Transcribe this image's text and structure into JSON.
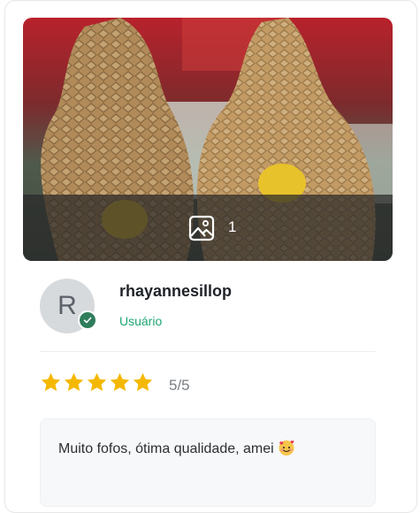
{
  "review": {
    "photo": {
      "icon": "image-icon",
      "count": "1"
    },
    "user": {
      "avatar_initial": "R",
      "name": "rhayannesillop",
      "role": "Usuário",
      "verified_icon": "check-badge-icon"
    },
    "rating": {
      "value": 5,
      "max": 5,
      "text": "5/5",
      "star_color": "#f5b800"
    },
    "comment": {
      "text": "Muito fofos, ótima qualidade, amei",
      "emoji": "smiling-face-with-hearts-emoji"
    }
  },
  "colors": {
    "accent_green": "#1ea672",
    "verified_green": "#2e7d5b"
  }
}
